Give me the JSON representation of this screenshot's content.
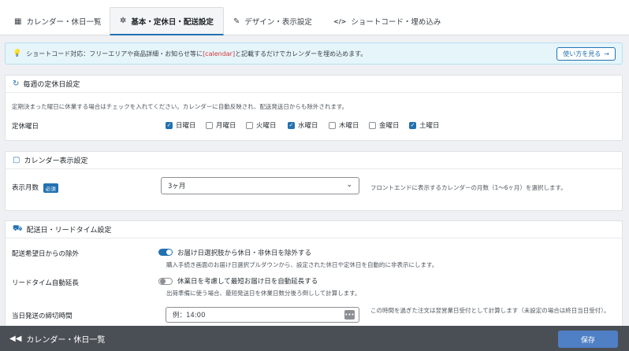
{
  "tabs": [
    {
      "icon": "calendar-icon",
      "glyph": "▦",
      "label": "カレンダー・休日一覧"
    },
    {
      "icon": "gear-icon",
      "glyph": "✲",
      "label": "基本・定休日・配送設定"
    },
    {
      "icon": "brush-icon",
      "glyph": "✎",
      "label": "デザイン・表示設定"
    },
    {
      "icon": "code-icon",
      "glyph": "</>",
      "label": "ショートコード・埋め込み"
    }
  ],
  "notice": {
    "prefix": "ショートコード対応：",
    "text_before": "フリーエリアや商品詳細・お知らせ等に ",
    "code": "[calendar]",
    "text_after": " と記載するだけでカレンダーを埋め込めます。",
    "help_label": "使い方を見る",
    "help_arrow": "→"
  },
  "weekly": {
    "title": "毎週の定休日設定",
    "description": "定期決まった曜日に休業する場合はチェックを入れてください。カレンダーに自動反映され、配送発送日からも除外されます。",
    "label": "定休曜日",
    "days": [
      {
        "label": "日曜日",
        "checked": true
      },
      {
        "label": "月曜日",
        "checked": false
      },
      {
        "label": "火曜日",
        "checked": false
      },
      {
        "label": "水曜日",
        "checked": true
      },
      {
        "label": "木曜日",
        "checked": false
      },
      {
        "label": "金曜日",
        "checked": false
      },
      {
        "label": "土曜日",
        "checked": true
      }
    ]
  },
  "display": {
    "title": "カレンダー表示設定",
    "label": "表示月数",
    "required": "必須",
    "selected": "3ヶ月",
    "help": "フロントエンドに表示するカレンダーの月数（1〜6ヶ月）を選択します。"
  },
  "delivery": {
    "title": "配送日・リードタイム設定",
    "exclude_label": "配送希望日からの除外",
    "exclude_toggle": "お届け日選択肢から休日・非休日を除外する",
    "exclude_desc": "購入手続き画面のお届け日選択プルダウンから、設定された休日や定休日を自動的に非表示にします。",
    "exclude_on": true,
    "lead_label": "リードタイム自動延長",
    "lead_toggle": "休業日を考慮して最短お届け日を自動延長する",
    "lead_desc": "出荷準備に使う場合、最短発送日を休業日数分後ろ倒しして計算します。",
    "lead_on": false,
    "cutoff_label": "当日発送の締切時間",
    "cutoff_value": "例：14:00",
    "cutoff_help": "この時間を過ぎた注文は翌営業日受付として計算します（未設定の場合は終日当日受付）。"
  },
  "footer": {
    "back_label": "カレンダー・休日一覧",
    "save_label": "保存"
  }
}
